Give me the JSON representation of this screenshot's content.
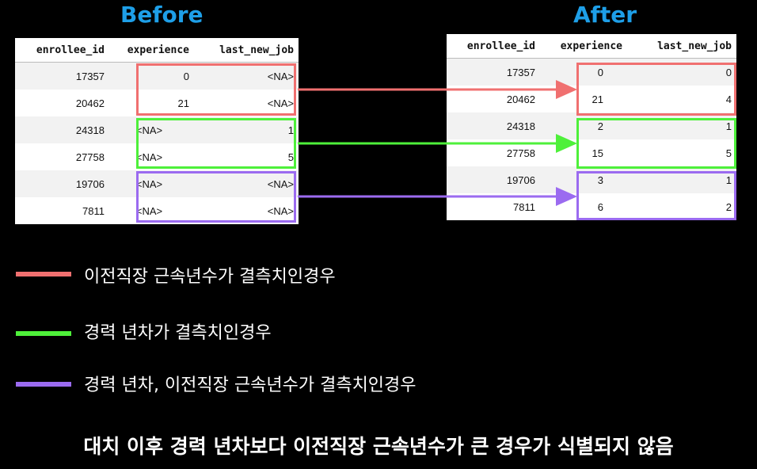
{
  "before": {
    "title": "Before",
    "columns": [
      "enrollee_id",
      "experience",
      "last_new_job"
    ],
    "rows": [
      [
        "17357",
        "0",
        "<NA>"
      ],
      [
        "20462",
        "21",
        "<NA>"
      ],
      [
        "24318",
        "<NA>",
        "1"
      ],
      [
        "27758",
        "<NA>",
        "5"
      ],
      [
        "19706",
        "<NA>",
        "<NA>"
      ],
      [
        "7811",
        "<NA>",
        "<NA>"
      ]
    ]
  },
  "after": {
    "title": "After",
    "columns": [
      "enrollee_id",
      "experience",
      "last_new_job"
    ],
    "rows": [
      [
        "17357",
        "0",
        "0"
      ],
      [
        "20462",
        "21",
        "4"
      ],
      [
        "24318",
        "2",
        "1"
      ],
      [
        "27758",
        "15",
        "5"
      ],
      [
        "19706",
        "3",
        "1"
      ],
      [
        "7811",
        "6",
        "2"
      ]
    ]
  },
  "colors": {
    "title": "#1E9FE8",
    "red": "#F07070",
    "green": "#4EF03A",
    "purple": "#9B6BF0"
  },
  "legend": [
    {
      "color": "red",
      "text": "이전직장 근속년수가 결측치인경우"
    },
    {
      "color": "green",
      "text": "경력 년차가 결측치인경우"
    },
    {
      "color": "purple",
      "text": "경력 년차, 이전직장 근속년수가 결측치인경우"
    }
  ],
  "conclusion": "대치 이후 경력 년차보다 이전직장 근속년수가 큰 경우가 식별되지 않음"
}
